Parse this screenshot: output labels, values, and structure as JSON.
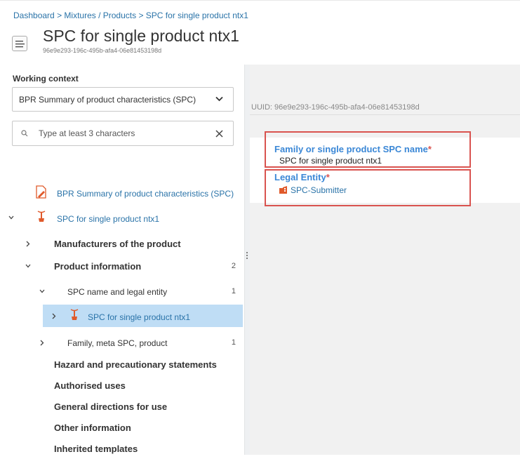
{
  "breadcrumb": {
    "items": [
      "Dashboard",
      "Mixtures / Products",
      "SPC for single product ntx1"
    ],
    "separator": ">"
  },
  "header": {
    "title": "SPC for single product ntx1",
    "uuid": "96e9e293-196c-495b-afa4-06e81453198d"
  },
  "working_context": {
    "label": "Working context",
    "selected": "BPR Summary of product characteristics (SPC)"
  },
  "search": {
    "placeholder": "Type at least 3 characters",
    "value": ""
  },
  "tree": {
    "root_doc": "BPR Summary of product characteristics (SPC)",
    "root": "SPC for single product ntx1",
    "manufacturers": "Manufacturers of the product",
    "product_info": {
      "label": "Product information",
      "count": "2"
    },
    "spc_name": {
      "label": "SPC name and legal entity",
      "count": "1"
    },
    "selected_item": "SPC for single product ntx1",
    "family": {
      "label": "Family, meta SPC, product",
      "count": "1"
    },
    "hazard": "Hazard and precautionary statements",
    "uses": "Authorised uses",
    "directions": "General directions for use",
    "other": "Other information",
    "inherited": "Inherited templates"
  },
  "detail": {
    "uuid_line": "UUID: 96e9e293-196c-495b-afa4-06e81453198d",
    "name_field": {
      "label": "Family or single product SPC name",
      "required_mark": "*",
      "value": "SPC for single product ntx1"
    },
    "legal_entity": {
      "label": "Legal Entity",
      "required_mark": "*",
      "value": "SPC-Submitter"
    }
  },
  "colors": {
    "link": "#2a73a8",
    "field_label": "#3a87d6",
    "required": "#d9534f",
    "highlight_border": "#d9534f",
    "selected_row": "#bfddf5",
    "icon_orange": "#e05a2b"
  },
  "icons": [
    "menu-icon",
    "chevron-down-icon",
    "search-icon",
    "close-icon",
    "document-edit-icon",
    "product-icon",
    "entity-icon"
  ]
}
